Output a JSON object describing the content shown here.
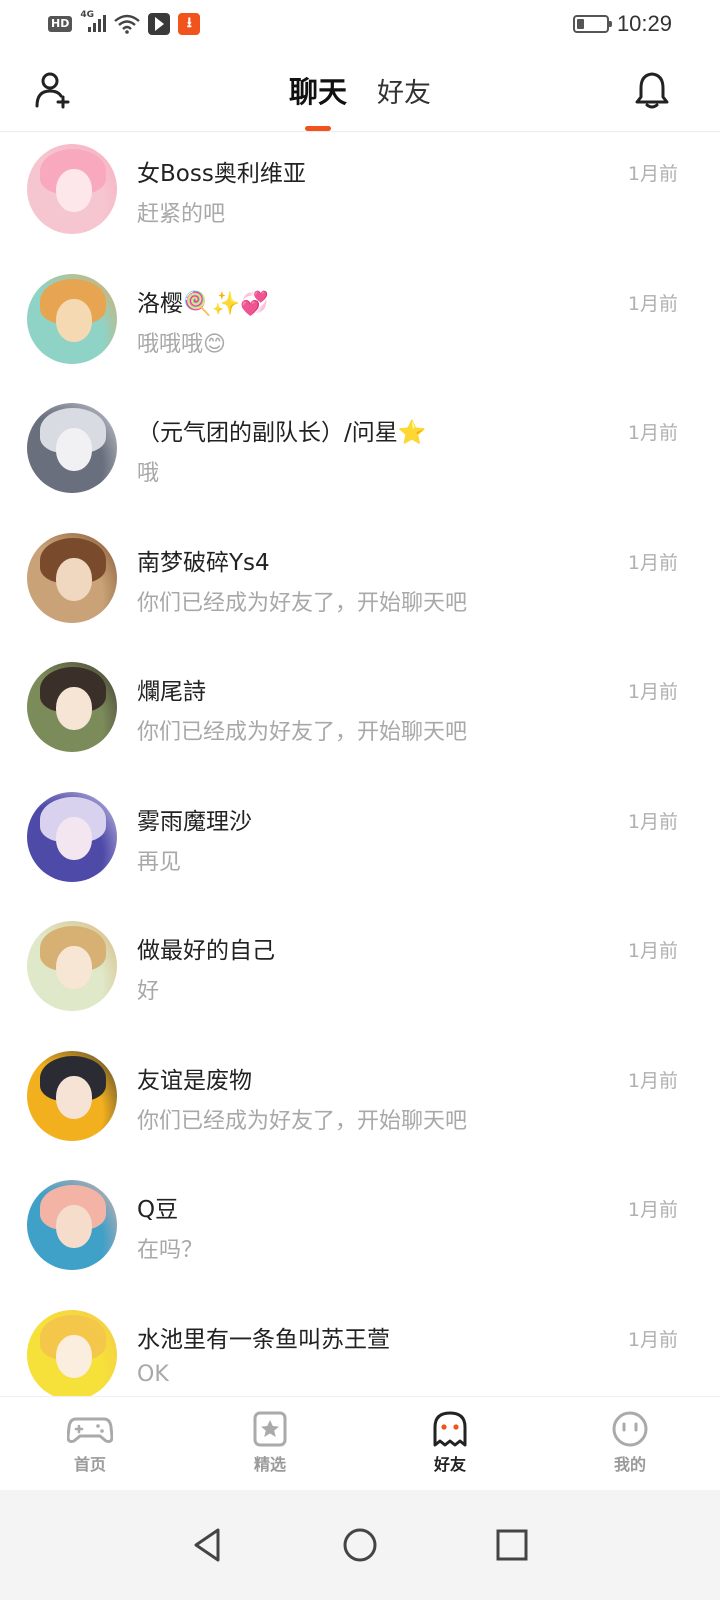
{
  "status_bar": {
    "hd_label": "HD",
    "network_label": "4G",
    "download_icon_glyph": "⭳",
    "time": "10:29"
  },
  "header": {
    "tabs": [
      {
        "label": "聊天",
        "active": true
      },
      {
        "label": "好友",
        "active": false
      }
    ],
    "accent_color": "#f0531c"
  },
  "chats": [
    {
      "name": "女Boss奥利维亚",
      "preview": "赶紧的吧",
      "time": "1月前",
      "avatar_colors": [
        "#f6c6d0",
        "#f9a9bd",
        "#fde7ea"
      ]
    },
    {
      "name": "洛樱🍭✨💞",
      "preview": "哦哦哦😊",
      "time": "1月前",
      "avatar_colors": [
        "#8fd3c7",
        "#e7a552",
        "#f5d9b3"
      ]
    },
    {
      "name": "（元气团的副队长）/问星⭐",
      "preview": "哦",
      "time": "1月前",
      "avatar_colors": [
        "#6a6f7e",
        "#d9dbe3",
        "#f1f1f4"
      ]
    },
    {
      "name": "南梦破碎Ys4",
      "preview": "你们已经成为好友了，开始聊天吧",
      "time": "1月前",
      "avatar_colors": [
        "#c9a277",
        "#7a4a2c",
        "#efd8bf"
      ]
    },
    {
      "name": "爛尾詩",
      "preview": "你们已经成为好友了，开始聊天吧",
      "time": "1月前",
      "avatar_colors": [
        "#7b8c5a",
        "#3b2f2a",
        "#f6e4d4"
      ]
    },
    {
      "name": "雾雨魔理沙",
      "preview": "再见",
      "time": "1月前",
      "avatar_colors": [
        "#4e4aa8",
        "#d9d2ee",
        "#f3e6f0"
      ]
    },
    {
      "name": "做最好的自己",
      "preview": "好",
      "time": "1月前",
      "avatar_colors": [
        "#dfe8c8",
        "#d7b074",
        "#f8e6d5"
      ]
    },
    {
      "name": "友谊是废物",
      "preview": "你们已经成为好友了，开始聊天吧",
      "time": "1月前",
      "avatar_colors": [
        "#f2b01e",
        "#2b2b33",
        "#f7e2d6"
      ]
    },
    {
      "name": "Q豆",
      "preview": "在吗？",
      "time": "1月前",
      "avatar_colors": [
        "#3fa0c8",
        "#f3b3a5",
        "#f6dccb"
      ]
    },
    {
      "name": "水池里有一条鱼叫苏王萱",
      "preview": "OK",
      "time": "1月前",
      "avatar_colors": [
        "#f6e03a",
        "#f4c64a",
        "#fbeede"
      ]
    }
  ],
  "bottom_nav": [
    {
      "label": "首页",
      "icon": "gamepad-icon",
      "active": false
    },
    {
      "label": "精选",
      "icon": "star-icon",
      "active": false
    },
    {
      "label": "好友",
      "icon": "ghost-icon",
      "active": true
    },
    {
      "label": "我的",
      "icon": "smiley-icon",
      "active": false
    }
  ]
}
